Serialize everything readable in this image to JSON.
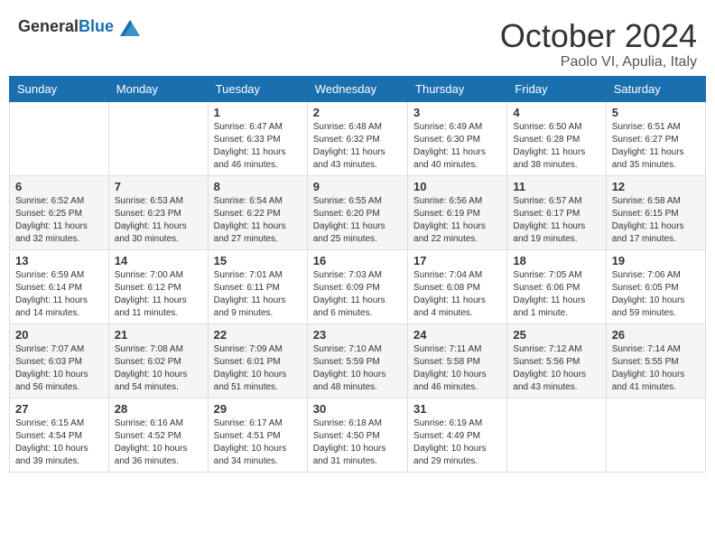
{
  "header": {
    "logo_general": "General",
    "logo_blue": "Blue",
    "month": "October 2024",
    "location": "Paolo VI, Apulia, Italy"
  },
  "weekdays": [
    "Sunday",
    "Monday",
    "Tuesday",
    "Wednesday",
    "Thursday",
    "Friday",
    "Saturday"
  ],
  "weeks": [
    [
      {
        "day": "",
        "info": ""
      },
      {
        "day": "",
        "info": ""
      },
      {
        "day": "1",
        "info": "Sunrise: 6:47 AM\nSunset: 6:33 PM\nDaylight: 11 hours and 46 minutes."
      },
      {
        "day": "2",
        "info": "Sunrise: 6:48 AM\nSunset: 6:32 PM\nDaylight: 11 hours and 43 minutes."
      },
      {
        "day": "3",
        "info": "Sunrise: 6:49 AM\nSunset: 6:30 PM\nDaylight: 11 hours and 40 minutes."
      },
      {
        "day": "4",
        "info": "Sunrise: 6:50 AM\nSunset: 6:28 PM\nDaylight: 11 hours and 38 minutes."
      },
      {
        "day": "5",
        "info": "Sunrise: 6:51 AM\nSunset: 6:27 PM\nDaylight: 11 hours and 35 minutes."
      }
    ],
    [
      {
        "day": "6",
        "info": "Sunrise: 6:52 AM\nSunset: 6:25 PM\nDaylight: 11 hours and 32 minutes."
      },
      {
        "day": "7",
        "info": "Sunrise: 6:53 AM\nSunset: 6:23 PM\nDaylight: 11 hours and 30 minutes."
      },
      {
        "day": "8",
        "info": "Sunrise: 6:54 AM\nSunset: 6:22 PM\nDaylight: 11 hours and 27 minutes."
      },
      {
        "day": "9",
        "info": "Sunrise: 6:55 AM\nSunset: 6:20 PM\nDaylight: 11 hours and 25 minutes."
      },
      {
        "day": "10",
        "info": "Sunrise: 6:56 AM\nSunset: 6:19 PM\nDaylight: 11 hours and 22 minutes."
      },
      {
        "day": "11",
        "info": "Sunrise: 6:57 AM\nSunset: 6:17 PM\nDaylight: 11 hours and 19 minutes."
      },
      {
        "day": "12",
        "info": "Sunrise: 6:58 AM\nSunset: 6:15 PM\nDaylight: 11 hours and 17 minutes."
      }
    ],
    [
      {
        "day": "13",
        "info": "Sunrise: 6:59 AM\nSunset: 6:14 PM\nDaylight: 11 hours and 14 minutes."
      },
      {
        "day": "14",
        "info": "Sunrise: 7:00 AM\nSunset: 6:12 PM\nDaylight: 11 hours and 11 minutes."
      },
      {
        "day": "15",
        "info": "Sunrise: 7:01 AM\nSunset: 6:11 PM\nDaylight: 11 hours and 9 minutes."
      },
      {
        "day": "16",
        "info": "Sunrise: 7:03 AM\nSunset: 6:09 PM\nDaylight: 11 hours and 6 minutes."
      },
      {
        "day": "17",
        "info": "Sunrise: 7:04 AM\nSunset: 6:08 PM\nDaylight: 11 hours and 4 minutes."
      },
      {
        "day": "18",
        "info": "Sunrise: 7:05 AM\nSunset: 6:06 PM\nDaylight: 11 hours and 1 minute."
      },
      {
        "day": "19",
        "info": "Sunrise: 7:06 AM\nSunset: 6:05 PM\nDaylight: 10 hours and 59 minutes."
      }
    ],
    [
      {
        "day": "20",
        "info": "Sunrise: 7:07 AM\nSunset: 6:03 PM\nDaylight: 10 hours and 56 minutes."
      },
      {
        "day": "21",
        "info": "Sunrise: 7:08 AM\nSunset: 6:02 PM\nDaylight: 10 hours and 54 minutes."
      },
      {
        "day": "22",
        "info": "Sunrise: 7:09 AM\nSunset: 6:01 PM\nDaylight: 10 hours and 51 minutes."
      },
      {
        "day": "23",
        "info": "Sunrise: 7:10 AM\nSunset: 5:59 PM\nDaylight: 10 hours and 48 minutes."
      },
      {
        "day": "24",
        "info": "Sunrise: 7:11 AM\nSunset: 5:58 PM\nDaylight: 10 hours and 46 minutes."
      },
      {
        "day": "25",
        "info": "Sunrise: 7:12 AM\nSunset: 5:56 PM\nDaylight: 10 hours and 43 minutes."
      },
      {
        "day": "26",
        "info": "Sunrise: 7:14 AM\nSunset: 5:55 PM\nDaylight: 10 hours and 41 minutes."
      }
    ],
    [
      {
        "day": "27",
        "info": "Sunrise: 6:15 AM\nSunset: 4:54 PM\nDaylight: 10 hours and 39 minutes."
      },
      {
        "day": "28",
        "info": "Sunrise: 6:16 AM\nSunset: 4:52 PM\nDaylight: 10 hours and 36 minutes."
      },
      {
        "day": "29",
        "info": "Sunrise: 6:17 AM\nSunset: 4:51 PM\nDaylight: 10 hours and 34 minutes."
      },
      {
        "day": "30",
        "info": "Sunrise: 6:18 AM\nSunset: 4:50 PM\nDaylight: 10 hours and 31 minutes."
      },
      {
        "day": "31",
        "info": "Sunrise: 6:19 AM\nSunset: 4:49 PM\nDaylight: 10 hours and 29 minutes."
      },
      {
        "day": "",
        "info": ""
      },
      {
        "day": "",
        "info": ""
      }
    ]
  ]
}
